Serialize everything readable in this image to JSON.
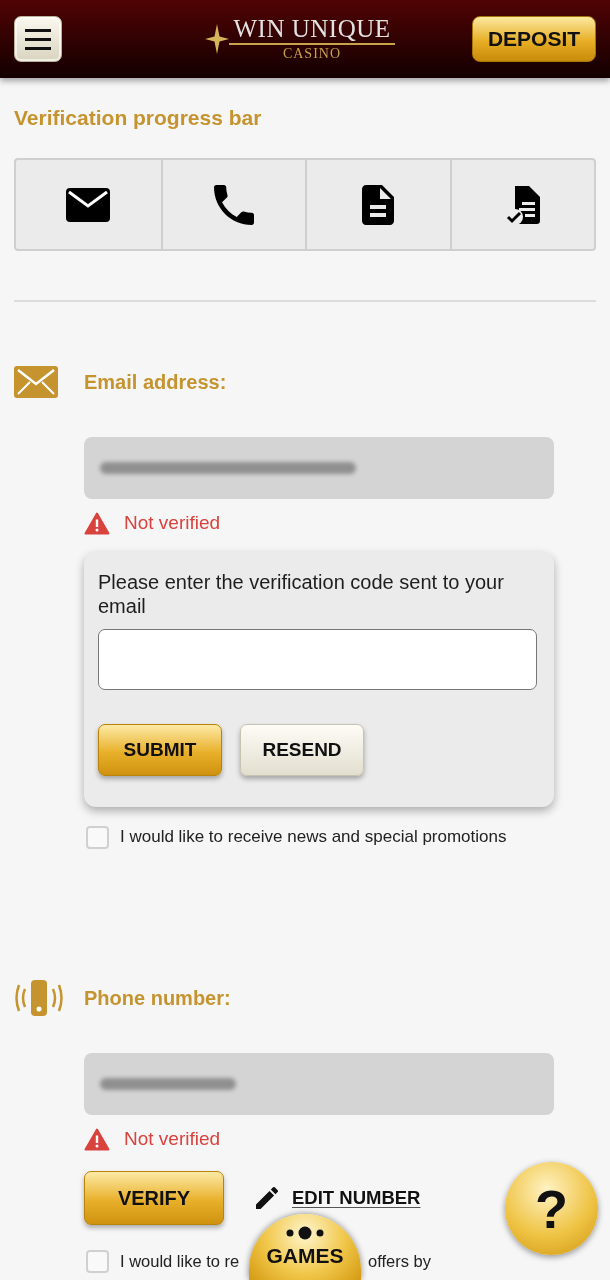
{
  "header": {
    "logo": {
      "title": "WIN UNIQUE",
      "subtitle": "CASINO"
    },
    "deposit_button": "DEPOSIT"
  },
  "heading": "Verification progress bar",
  "progress_steps": [
    {
      "kind": "email"
    },
    {
      "kind": "phone"
    },
    {
      "kind": "document"
    },
    {
      "kind": "document_check"
    }
  ],
  "sections": [
    {
      "kind": "email",
      "label": "Email address:",
      "status": {
        "verified": false,
        "text": "Not verified"
      },
      "code_box": {
        "prompt": "Please enter the verification code sent to your email",
        "buttons": [
          {
            "kind": "primary",
            "label": "SUBMIT"
          },
          {
            "kind": "secondary",
            "label": "RESEND"
          }
        ]
      },
      "checkbox": {
        "checked": false,
        "label_parts": [
          "I would like to receive news and special promotions"
        ]
      }
    },
    {
      "kind": "phone",
      "label": "Phone number:",
      "status": {
        "verified": false,
        "text": "Not verified"
      },
      "actions": [
        {
          "kind": "primary",
          "label": "VERIFY"
        },
        {
          "kind": "link",
          "label": "EDIT NUMBER"
        }
      ],
      "checkbox": {
        "checked": false,
        "label_parts": [
          "I would like to re",
          "offers by"
        ]
      }
    }
  ],
  "games_button": {
    "label": "GAMES"
  },
  "help_button": {
    "label": "?"
  }
}
